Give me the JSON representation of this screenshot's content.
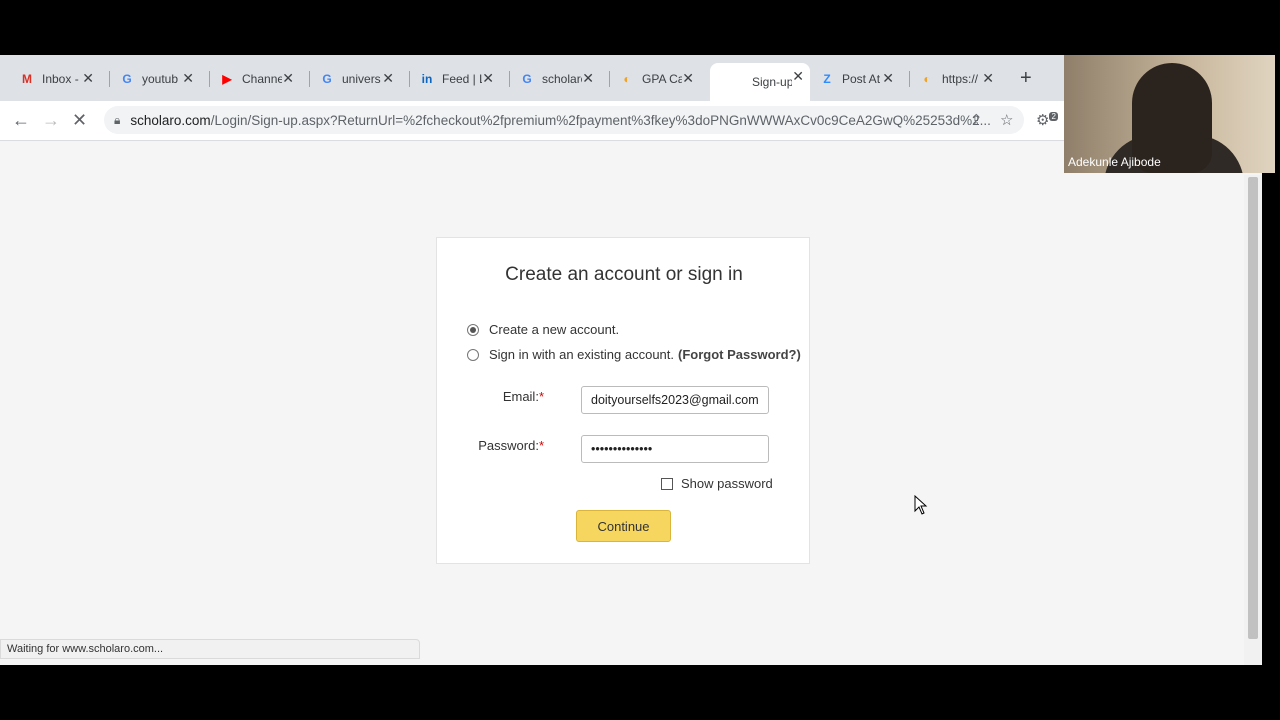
{
  "tabs": [
    {
      "title": "Inbox -",
      "icon": "gmail-icon",
      "glyph": "M",
      "color": "#d93025"
    },
    {
      "title": "youtub",
      "icon": "google-icon",
      "glyph": "G",
      "color": "#4285f4"
    },
    {
      "title": "Channe",
      "icon": "youtube-icon",
      "glyph": "▶",
      "color": "#ff0000"
    },
    {
      "title": "univers",
      "icon": "google-icon",
      "glyph": "G",
      "color": "#4285f4"
    },
    {
      "title": "Feed | L",
      "icon": "linkedin-icon",
      "glyph": "in",
      "color": "#0a66c2"
    },
    {
      "title": "scholarc",
      "icon": "google-icon",
      "glyph": "G",
      "color": "#4285f4"
    },
    {
      "title": "GPA Cal",
      "icon": "scholaro-icon",
      "glyph": "◐",
      "color": "#f4a11d"
    },
    {
      "title": "Sign-up",
      "icon": "loading-icon",
      "glyph": "",
      "color": "#1a73e8"
    },
    {
      "title": "Post At",
      "icon": "zoom-icon",
      "glyph": "Z",
      "color": "#2d8cff"
    },
    {
      "title": "https://",
      "icon": "scholaro-icon",
      "glyph": "◐",
      "color": "#f4a11d"
    }
  ],
  "toolbar": {
    "url_host": "scholaro.com",
    "url_path": "/Login/Sign-up.aspx?ReturnUrl=%2fcheckout%2fpremium%2fpayment%3fkey%3doPNGnWWWAxCv0c9CeA2GwQ%25253d%2...",
    "extension_badge": "2"
  },
  "form": {
    "heading": "Create an account or sign in",
    "option_new": "Create a new account.",
    "option_existing": "Sign in with an existing account.",
    "forgot_password": "(Forgot Password?)",
    "email_label": "Email:",
    "email_value": "doityourselfs2023@gmail.com",
    "password_label": "Password:",
    "password_value": "••••••••••••••",
    "required_mark": "*",
    "show_password": "Show password",
    "continue": "Continue"
  },
  "status": "Waiting for www.scholaro.com...",
  "video": {
    "participant_name": "Adekunle Ajibode"
  }
}
